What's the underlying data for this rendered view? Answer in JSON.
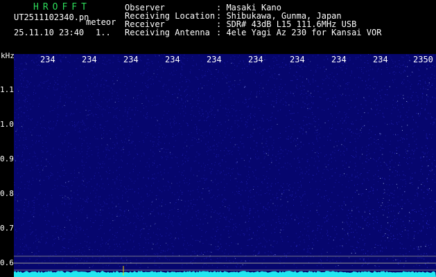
{
  "header": {
    "brand": "HROFFT",
    "filename": "UT2511102340.pn",
    "tag": "meteor",
    "datetime": "25.11.10 23:40",
    "counter": "1..",
    "info_labels": [
      "Observer",
      "Receiving Location",
      "Receiver",
      "Receiving Antenna"
    ],
    "info_values": [
      ": Masaki Kano",
      ": Shibukawa, Gunma, Japan",
      ": SDR# 43dB L15 111.6MHz USB",
      ": 4ele Yagi Az 230 for Kansai VOR"
    ]
  },
  "spectrogram": {
    "unit": "kHz",
    "y_ticks": [
      "1.1",
      "1.0",
      "0.9",
      "0.8",
      "0.7",
      "0.6"
    ],
    "x_ticks": [
      "234",
      "234",
      "234",
      "234",
      "234",
      "234",
      "234",
      "234",
      "234",
      "2350"
    ],
    "colors": {
      "background": "#06066e",
      "noise_dim": "#2a2ad0",
      "noise_bright": "#bcd4ff",
      "baseline": "#22e6f0",
      "marker": "#ffe000",
      "hline": "#d8d8a0"
    }
  }
}
